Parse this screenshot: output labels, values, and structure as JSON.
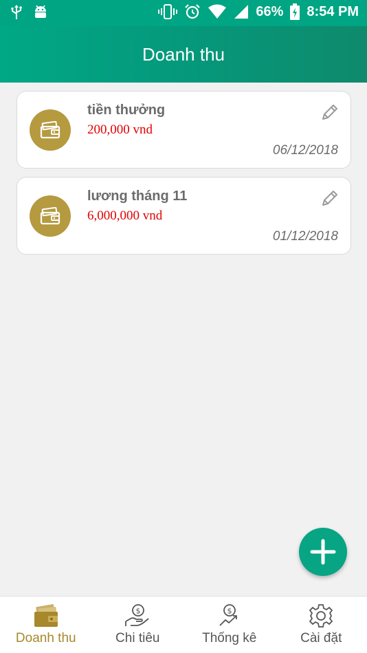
{
  "status_bar": {
    "battery": "66%",
    "time": "8:54 PM"
  },
  "header": {
    "title": "Doanh thu"
  },
  "transactions": [
    {
      "title": "tiền thưởng",
      "amount": "200,000 vnd",
      "date": "06/12/2018",
      "icon": "wallet-icon"
    },
    {
      "title": "lương tháng 11",
      "amount": "6,000,000 vnd",
      "date": "01/12/2018",
      "icon": "wallet-icon"
    }
  ],
  "fab": {
    "icon": "plus-icon"
  },
  "nav": {
    "items": [
      {
        "label": "Doanh thu",
        "icon": "wallet-icon",
        "active": true
      },
      {
        "label": "Chi tiêu",
        "icon": "hand-coin-icon",
        "active": false
      },
      {
        "label": "Thống kê",
        "icon": "chart-coin-icon",
        "active": false
      },
      {
        "label": "Cài đặt",
        "icon": "gear-icon",
        "active": false
      }
    ]
  },
  "colors": {
    "primary": "#00a583",
    "accent": "#b59a3f",
    "amount": "#e10000",
    "active_tab": "#a8882c"
  }
}
